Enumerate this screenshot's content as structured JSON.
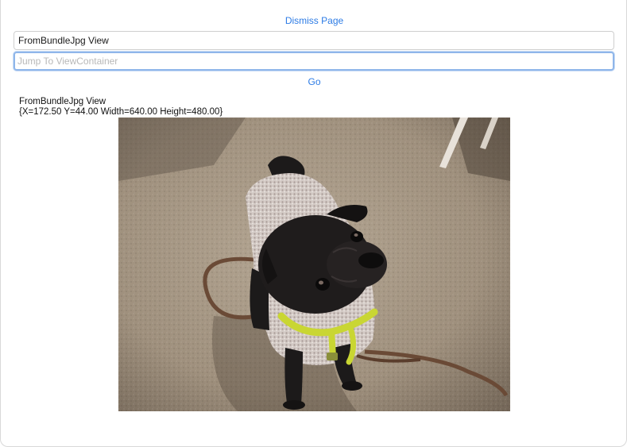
{
  "header": {
    "dismiss_label": "Dismiss Page"
  },
  "view_name_field": {
    "value": "FromBundleJpg View"
  },
  "jump_field": {
    "value": "",
    "placeholder": "Jump To ViewContainer"
  },
  "go_label": "Go",
  "info": {
    "title": "FromBundleJpg View",
    "frame": "{X=172.50 Y=44.00 Width=640.00 Height=480.00}"
  },
  "image": {
    "subject": "black pug wearing knit sweater and yellow harness on carpet",
    "colors": {
      "carpet": "#a59684",
      "carpet_dark": "#6f6254",
      "pug": "#1c1a1a",
      "sweater": "#cfc5c0",
      "harness": "#c9d633",
      "leash": "#6a4a36"
    }
  }
}
